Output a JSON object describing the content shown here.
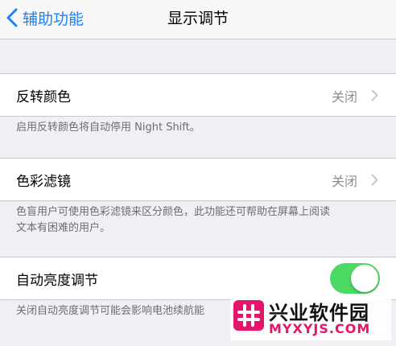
{
  "nav": {
    "back_label": "辅助功能",
    "title": "显示调节"
  },
  "invert": {
    "label": "反转颜色",
    "value": "关闭",
    "footer": "启用反转颜色将自动停用 Night Shift。"
  },
  "filters": {
    "label": "色彩滤镜",
    "value": "关闭",
    "footer_line1": "色盲用户可使用色彩滤镜来区分颜色，此功能还可帮助在屏幕上阅读",
    "footer_line2": "文本有困难的用户。"
  },
  "auto_brightness": {
    "label": "自动亮度调节",
    "enabled": true,
    "footer": "关闭自动亮度调节可能会影响电池续航能"
  },
  "watermark": {
    "brand": "兴业软件园",
    "url": "MYXYJS.COM"
  },
  "colors": {
    "accent": "#1a82fb",
    "toggle_on": "#4cd964",
    "background": "#efeff4",
    "watermark_pink": "#e6156c"
  }
}
